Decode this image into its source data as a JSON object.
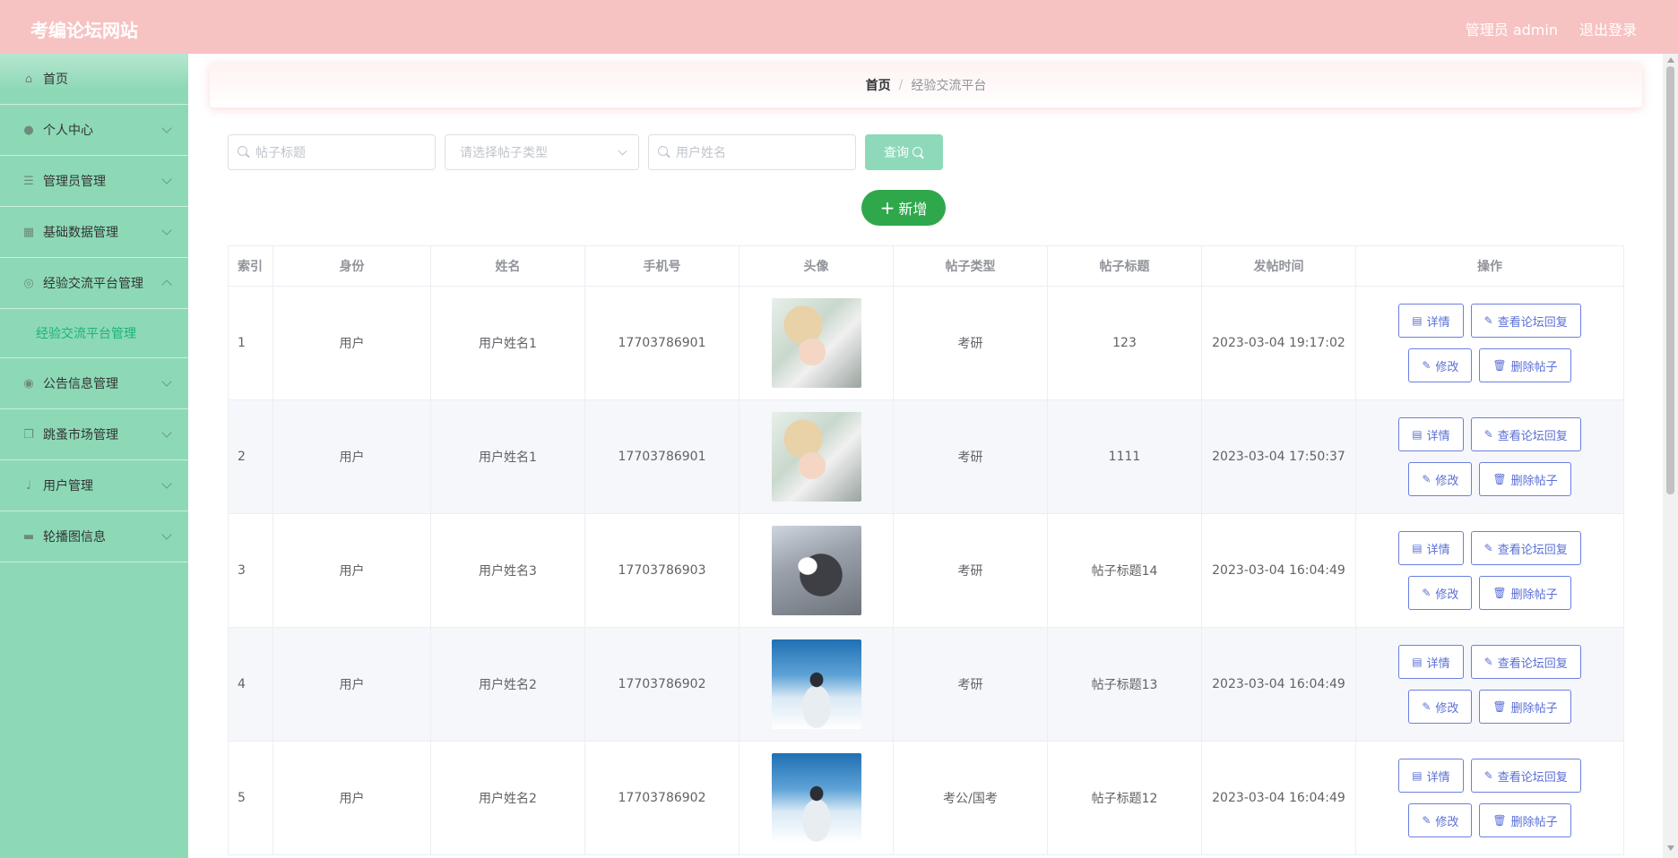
{
  "header": {
    "title": "考编论坛网站",
    "admin_label": "管理员 admin",
    "logout_label": "退出登录"
  },
  "sidebar": {
    "items": [
      {
        "label": "首页",
        "icon": "home-icon",
        "glyph": "⌂",
        "expandable": false
      },
      {
        "label": "个人中心",
        "icon": "user-icon",
        "glyph": "●",
        "expandable": true
      },
      {
        "label": "管理员管理",
        "icon": "list-icon",
        "glyph": "☰",
        "expandable": true
      },
      {
        "label": "基础数据管理",
        "icon": "grid-icon",
        "glyph": "▦",
        "expandable": true
      },
      {
        "label": "经验交流平台管理",
        "icon": "circle-icon",
        "glyph": "◎",
        "expandable": true,
        "expanded": true
      },
      {
        "label": "公告信息管理",
        "icon": "location-icon",
        "glyph": "◉",
        "expandable": true
      },
      {
        "label": "跳蚤市场管理",
        "icon": "copy-icon",
        "glyph": "❐",
        "expandable": true
      },
      {
        "label": "用户管理",
        "icon": "microphone-icon",
        "glyph": "♩",
        "expandable": true
      },
      {
        "label": "轮播图信息",
        "icon": "briefcase-icon",
        "glyph": "▬",
        "expandable": true
      }
    ],
    "submenu_label": "经验交流平台管理"
  },
  "breadcrumb": {
    "home": "首页",
    "separator": "/",
    "current": "经验交流平台"
  },
  "search": {
    "title_placeholder": "帖子标题",
    "type_placeholder": "请选择帖子类型",
    "username_placeholder": "用户姓名",
    "query_label": "查询",
    "add_label": "新增"
  },
  "table": {
    "headers": [
      "索引",
      "身份",
      "姓名",
      "手机号",
      "头像",
      "帖子类型",
      "帖子标题",
      "发帖时间",
      "操作"
    ],
    "rows": [
      {
        "index": "1",
        "role": "用户",
        "name": "用户姓名1",
        "phone": "17703786901",
        "avatar": "av1",
        "type": "考研",
        "title": "123",
        "time": "2023-03-04 19:17:02"
      },
      {
        "index": "2",
        "role": "用户",
        "name": "用户姓名1",
        "phone": "17703786901",
        "avatar": "av1",
        "type": "考研",
        "title": "1111",
        "time": "2023-03-04 17:50:37"
      },
      {
        "index": "3",
        "role": "用户",
        "name": "用户姓名3",
        "phone": "17703786903",
        "avatar": "av2",
        "type": "考研",
        "title": "帖子标题14",
        "time": "2023-03-04 16:04:49"
      },
      {
        "index": "4",
        "role": "用户",
        "name": "用户姓名2",
        "phone": "17703786902",
        "avatar": "av3",
        "type": "考研",
        "title": "帖子标题13",
        "time": "2023-03-04 16:04:49"
      },
      {
        "index": "5",
        "role": "用户",
        "name": "用户姓名2",
        "phone": "17703786902",
        "avatar": "av3",
        "type": "考公/国考",
        "title": "帖子标题12",
        "time": "2023-03-04 16:04:49"
      }
    ],
    "actions": {
      "detail": "详情",
      "view_replies": "查看论坛回复",
      "edit": "修改",
      "delete": "删除帖子"
    }
  },
  "colors": {
    "header_bg": "#f7c2c2",
    "sidebar_bg": "#8dd9b6",
    "add_button": "#2ea84a",
    "query_button": "#8ed9b9",
    "action_border": "#6b7fe0"
  }
}
